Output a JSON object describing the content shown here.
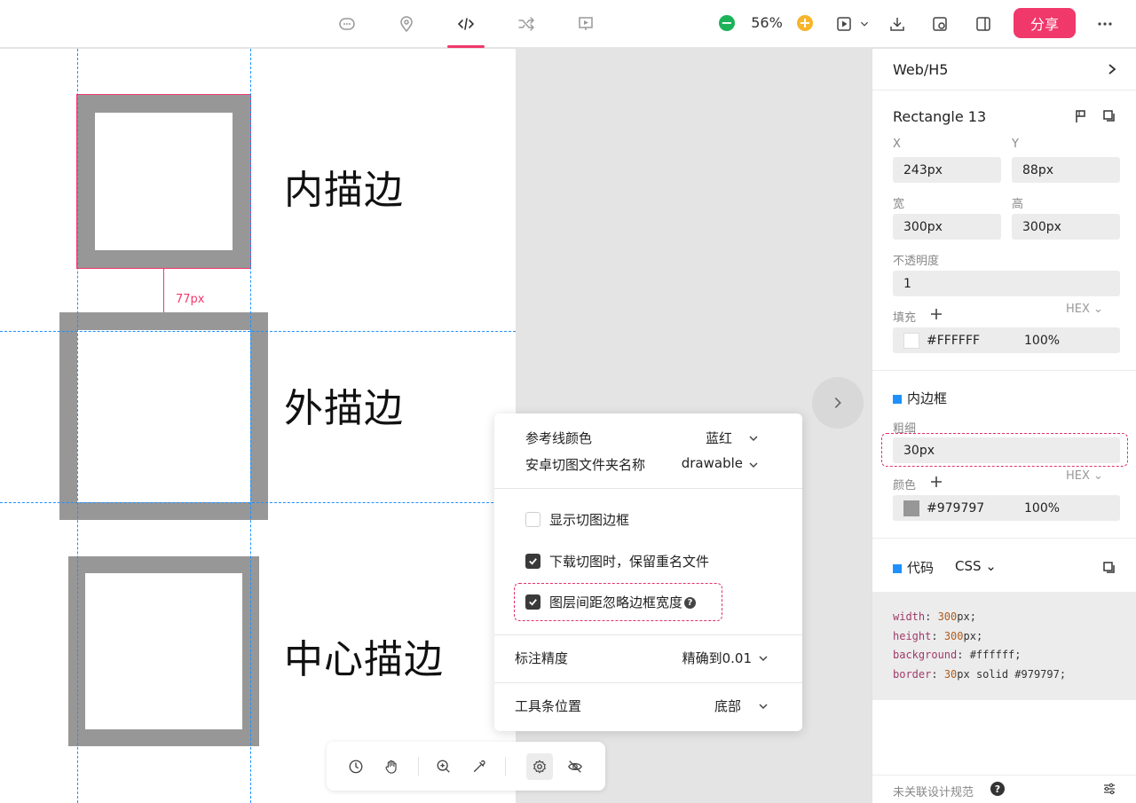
{
  "topbar": {
    "zoom": "56%",
    "share_label": "分享",
    "tabs": [
      "comment-icon",
      "location-icon",
      "code-icon",
      "shuffle-icon",
      "prototype-icon"
    ],
    "accent": "#f0386b"
  },
  "canvas": {
    "labels": {
      "inner": "内描边",
      "outer": "外描边",
      "center": "中心描边"
    },
    "measure": "77px",
    "stroke_color": "#979797"
  },
  "popover": {
    "guide_color_label": "参考线颜色",
    "guide_color_value": "蓝红",
    "android_folder_label": "安卓切图文件夹名称",
    "android_folder_value": "drawable",
    "show_slice_border": {
      "label": "显示切图边框",
      "checked": false
    },
    "keep_duplicate_files": {
      "label": "下载切图时，保留重名文件",
      "checked": true
    },
    "ignore_border_width": {
      "label": "图层间距忽略边框宽度",
      "checked": true
    },
    "precision_label": "标注精度",
    "precision_value": "精确到0.01",
    "toolbar_position_label": "工具条位置",
    "toolbar_position_value": "底部"
  },
  "panel": {
    "platform": "Web/H5",
    "layer_name": "Rectangle 13",
    "x_label": "X",
    "y_label": "Y",
    "x_value": "243px",
    "y_value": "88px",
    "width_label": "宽",
    "height_label": "高",
    "width_value": "300px",
    "height_value": "300px",
    "opacity_label": "不透明度",
    "opacity_value": "1",
    "fill_label": "填充",
    "fill_format": "HEX",
    "fill_color": "#FFFFFF",
    "fill_opacity": "100%",
    "border_section": "内边框",
    "border_width_label": "粗细",
    "border_width_value": "30px",
    "border_color_label": "颜色",
    "border_format": "HEX",
    "border_color": "#979797",
    "border_opacity": "100%",
    "code_section": "代码",
    "code_lang": "CSS",
    "code": [
      {
        "prop": "width",
        "num": "300",
        "rest": "px;"
      },
      {
        "prop": "height",
        "num": "300",
        "rest": "px;"
      },
      {
        "prop": "background",
        "num": "",
        "rest": "#ffffff;"
      },
      {
        "prop": "border",
        "num": "30",
        "rest": "px solid #979797;"
      }
    ],
    "footer": "未关联设计规范"
  }
}
